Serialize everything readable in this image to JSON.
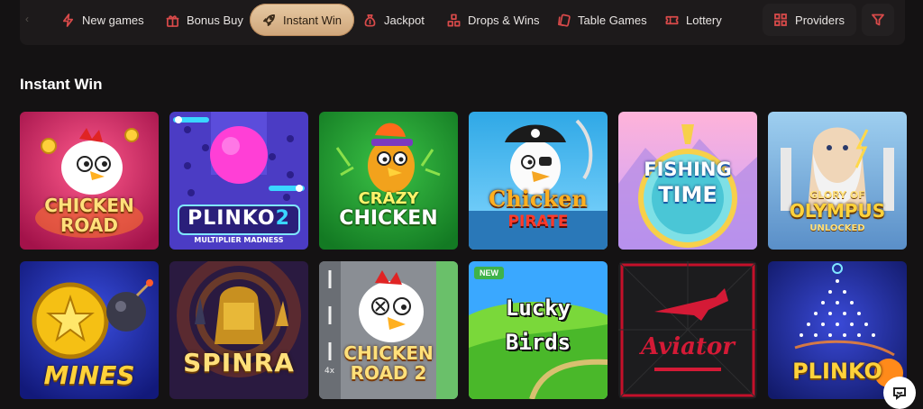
{
  "nav": {
    "items": [
      {
        "label": "New games",
        "icon": "lightning-icon"
      },
      {
        "label": "Bonus Buy",
        "icon": "gift-icon"
      },
      {
        "label": "Instant Win",
        "icon": "rocket-icon",
        "active": true
      },
      {
        "label": "Jackpot",
        "icon": "money-bag-icon"
      },
      {
        "label": "Drops & Wins",
        "icon": "blocks-icon"
      },
      {
        "label": "Table Games",
        "icon": "cards-icon"
      },
      {
        "label": "Lottery",
        "icon": "ticket-icon"
      }
    ],
    "providers_label": "Providers"
  },
  "section": {
    "title": "Instant Win"
  },
  "games": [
    {
      "title": "CHICKEN ROAD",
      "line1": "CHICKEN",
      "line2": "ROAD"
    },
    {
      "title": "PLINKO 2",
      "line1": "PLINKO",
      "line2": "2",
      "subtitle": "MULTIPLIER MADNESS"
    },
    {
      "title": "CRAZY CHICKEN",
      "line1": "CRAZY",
      "line2": "CHICKEN"
    },
    {
      "title": "Chicken PIRATE",
      "line1": "Chicken",
      "line2": "PIRATE"
    },
    {
      "title": "FISHING TIME",
      "line1": "FISHING",
      "line2": "TIME"
    },
    {
      "title": "GLORY OF OLYMPUS UNLOCKED",
      "line1": "GLORY OF",
      "line2": "OLYMPUS",
      "subtitle": "UNLOCKED"
    },
    {
      "title": "MINES",
      "line1": "MINES"
    },
    {
      "title": "SPINRA",
      "line1": "SPINRA"
    },
    {
      "title": "CHICKEN ROAD 2",
      "line1": "CHICKEN",
      "line2": "ROAD 2",
      "tag": "4x"
    },
    {
      "title": "Lucky Birds",
      "line1": "Lucky",
      "line2": "Birds",
      "badge": "NEW"
    },
    {
      "title": "Aviator",
      "line1": "Aviator"
    },
    {
      "title": "PLINKO",
      "line1": "PLINKO"
    }
  ],
  "colors": {
    "accent": "#d94a4a",
    "active_pill": "#e0bd93",
    "background": "#141213"
  }
}
